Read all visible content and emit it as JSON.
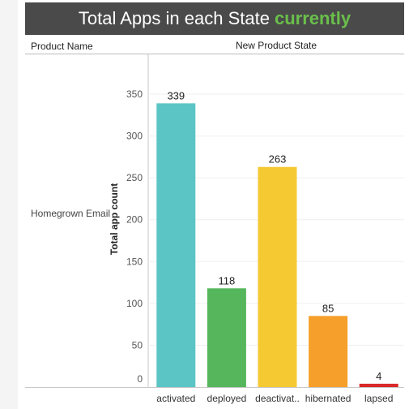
{
  "header": {
    "title_main": "Total Apps in each State",
    "title_accent": "currently",
    "accent_color": "#6abf4b",
    "bar_color": "#4a4a4a"
  },
  "table": {
    "row_header": "Product Name",
    "column_header": "New Product State",
    "row_label": "Homegrown Email"
  },
  "chart_data": {
    "type": "bar",
    "categories": [
      "activated",
      "deployed",
      "deactivat..",
      "hibernated",
      "lapsed"
    ],
    "values": [
      339,
      118,
      263,
      85,
      4
    ],
    "colors": [
      "#5bc5c5",
      "#55b65b",
      "#f5c932",
      "#f6a02b",
      "#d92828"
    ],
    "ylabel": "Total app count",
    "xlabel": "",
    "yticks": [
      0,
      50,
      100,
      150,
      200,
      250,
      300,
      350
    ],
    "ylim": [
      0,
      350
    ],
    "grid": true
  }
}
